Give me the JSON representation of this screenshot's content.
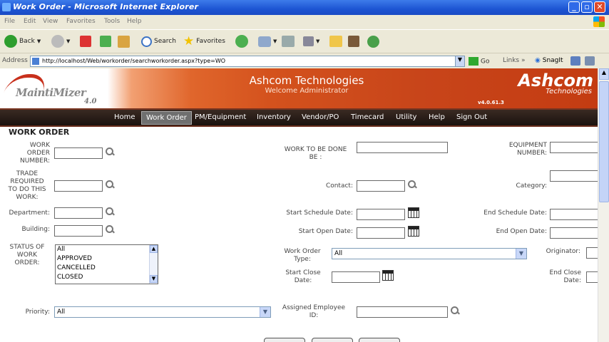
{
  "window": {
    "title": "Work Order - Microsoft Internet Explorer"
  },
  "menu": [
    "File",
    "Edit",
    "View",
    "Favorites",
    "Tools",
    "Help"
  ],
  "toolbar": {
    "back": "Back",
    "search": "Search",
    "favorites": "Favorites"
  },
  "address": {
    "label": "Address",
    "url": "http://localhost/Web/workorder/searchworkorder.aspx?type=WO",
    "go": "Go",
    "links": "Links",
    "snagit": "SnagIt"
  },
  "header": {
    "logo_text": "MaintiMizer",
    "logo_version": "4.0",
    "company": "Ashcom Technologies",
    "welcome": "Welcome Administrator",
    "brand": "Ashcom",
    "brand_sub": "Technologies",
    "version": "v4.0.61.3"
  },
  "nav": [
    "Home",
    "Work Order",
    "PM/Equipment",
    "Inventory",
    "Vendor/PO",
    "Timecard",
    "Utility",
    "Help",
    "Sign Out"
  ],
  "nav_active": "Work Order",
  "form": {
    "section_title": "WORK ORDER",
    "work_order_number": "WORK\nORDER\nNUMBER:",
    "work_to_be_done": "WORK TO BE DONE\nBE :",
    "equipment_number": "EQUIPMENT\nNUMBER:",
    "trade_required": "TRADE\nREQUIRED\nTO DO THIS\nWORK:",
    "contact": "Contact:",
    "category": "Category:",
    "department": "Department:",
    "start_schedule_date": "Start Schedule Date:",
    "end_schedule_date": "End Schedule Date:",
    "building": "Building:",
    "start_open_date": "Start Open Date:",
    "end_open_date": "End Open Date:",
    "status_label": "STATUS OF\nWORK\nORDER:",
    "status_options": [
      "All",
      "APPROVED",
      "CANCELLED",
      "CLOSED"
    ],
    "work_order_type": "Work Order\nType:",
    "work_order_type_value": "All",
    "originator": "Originator:",
    "start_close_date": "Start Close\nDate:",
    "end_close_date": "End Close\nDate:",
    "priority": "Priority:",
    "priority_value": "All",
    "assigned_employee": "Assigned Employee\nID:"
  }
}
